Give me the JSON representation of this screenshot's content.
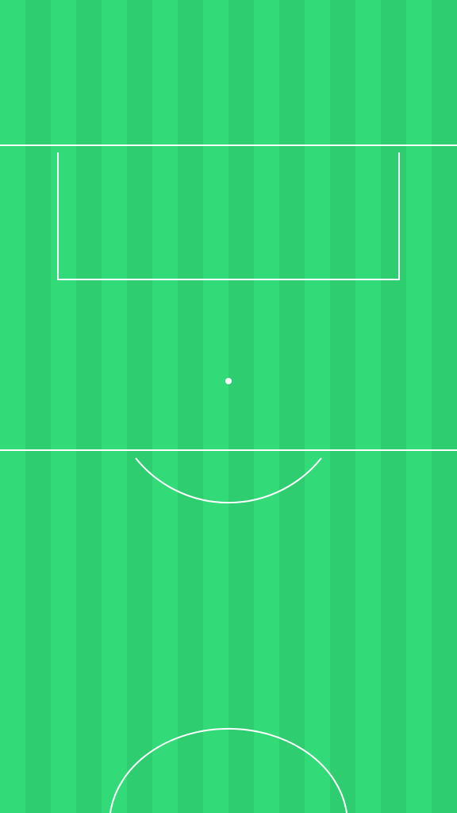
{
  "pitch": {
    "grass_light": "#32da78",
    "grass_dark": "#2ecd70",
    "line_color": "#ffffff",
    "stripe_count": 18
  }
}
